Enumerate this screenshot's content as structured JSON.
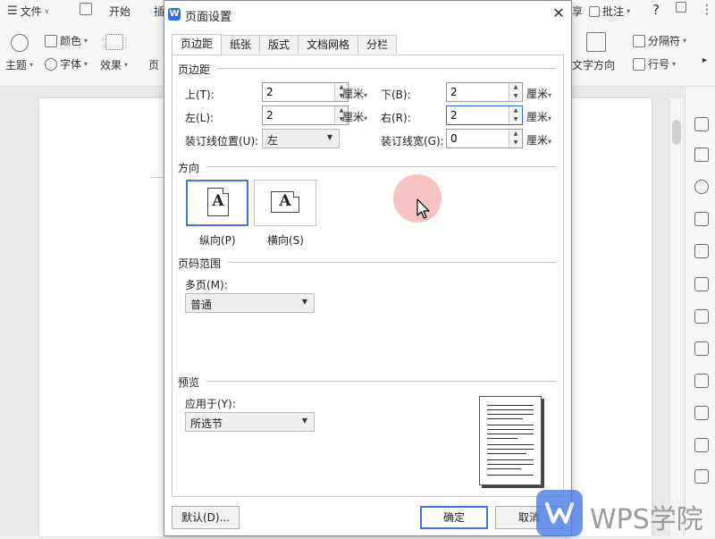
{
  "app": {
    "menu_file": "文件",
    "tab_start": "开始",
    "tab_insert_partial": "插",
    "tab_review_partial": "享",
    "annotate": "批注",
    "help": "?",
    "ribbon": {
      "color": "颜色",
      "theme": "主题",
      "font": "字体",
      "effect": "效果",
      "page_partial": "页",
      "text_direction": "文字方向",
      "separator": "分隔符",
      "line_number": "行号"
    }
  },
  "dialog": {
    "title": "页面设置",
    "tabs": [
      "页边距",
      "纸张",
      "版式",
      "文档网格",
      "分栏"
    ],
    "active_tab": "页边距",
    "margins": {
      "section": "页边距",
      "top_label": "上(T):",
      "top_value": "2",
      "top_unit": "厘米",
      "bottom_label": "下(B):",
      "bottom_value": "2",
      "bottom_unit": "厘米",
      "left_label": "左(L):",
      "left_value": "2",
      "left_unit": "厘米",
      "right_label": "右(R):",
      "right_value": "2",
      "right_unit": "厘米",
      "gutter_pos_label": "装订线位置(U):",
      "gutter_pos_value": "左",
      "gutter_width_label": "装订线宽(G):",
      "gutter_width_value": "0",
      "gutter_width_unit": "厘米"
    },
    "orientation": {
      "section": "方向",
      "glyph": "A",
      "portrait": "纵向(P)",
      "landscape": "横向(S)",
      "selected": "portrait"
    },
    "page_range": {
      "section": "页码范围",
      "multiple_label": "多页(M):",
      "multiple_value": "普通"
    },
    "preview": {
      "section": "预览",
      "apply_label": "应用于(Y):",
      "apply_value": "所选节"
    },
    "buttons": {
      "default": "默认(D)...",
      "ok": "确定",
      "cancel": "取消"
    }
  },
  "watermark": {
    "text": "WPS学院"
  },
  "colors": {
    "accent": "#3a7bd8",
    "brand": "#2f6fe0",
    "cursor_highlight": "#f07878"
  }
}
